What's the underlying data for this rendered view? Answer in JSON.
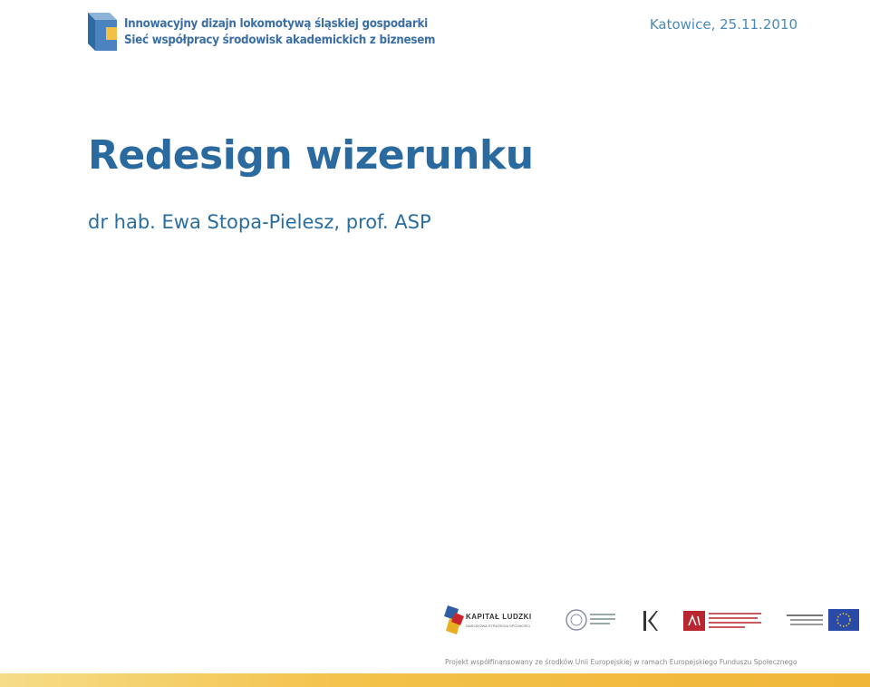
{
  "header": {
    "logo_line1": "Innowacyjny dizajn lokomotywą śląskiej gospodarki",
    "logo_line2": "Sieć współpracy środowisk akademickich z biznesem",
    "date": "Katowice, 25.11.2010"
  },
  "slide": {
    "title": "Redesign wizerunku",
    "subtitle": "dr hab. Ewa Stopa-Pielesz, prof. ASP"
  },
  "footer": {
    "kapital_ludzki": "KAPITAŁ LUDZKI",
    "kapital_ludzki_sub": "NARODOWA STRATEGIA SPÓJNOŚCI",
    "note": "Projekt współfinansowany ze środków Unii Europejskiej w ramach Europejskiego Funduszu Społecznego"
  },
  "colors": {
    "title": "#2b6a9e",
    "accent": "#3b6ea5",
    "bottom_bar": "#f3c24a"
  }
}
